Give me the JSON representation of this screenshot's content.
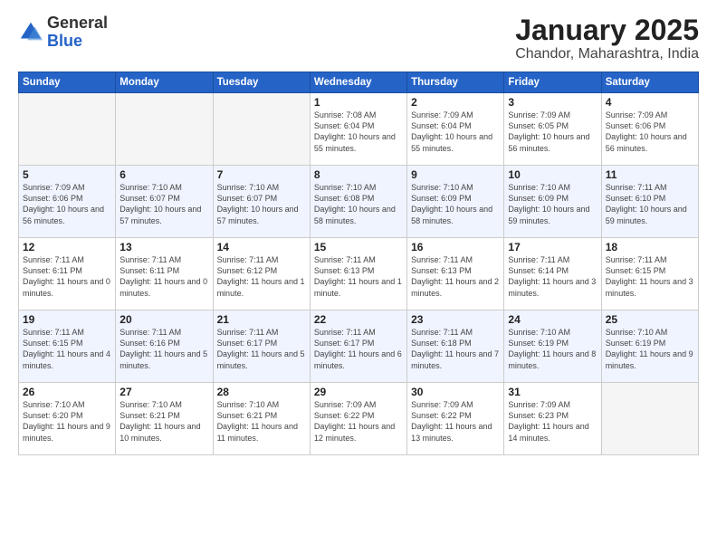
{
  "logo": {
    "general": "General",
    "blue": "Blue"
  },
  "title": "January 2025",
  "subtitle": "Chandor, Maharashtra, India",
  "days_of_week": [
    "Sunday",
    "Monday",
    "Tuesday",
    "Wednesday",
    "Thursday",
    "Friday",
    "Saturday"
  ],
  "weeks": [
    [
      {
        "num": "",
        "sunrise": "",
        "sunset": "",
        "daylight": "",
        "empty": true
      },
      {
        "num": "",
        "sunrise": "",
        "sunset": "",
        "daylight": "",
        "empty": true
      },
      {
        "num": "",
        "sunrise": "",
        "sunset": "",
        "daylight": "",
        "empty": true
      },
      {
        "num": "1",
        "sunrise": "Sunrise: 7:08 AM",
        "sunset": "Sunset: 6:04 PM",
        "daylight": "Daylight: 10 hours and 55 minutes.",
        "empty": false
      },
      {
        "num": "2",
        "sunrise": "Sunrise: 7:09 AM",
        "sunset": "Sunset: 6:04 PM",
        "daylight": "Daylight: 10 hours and 55 minutes.",
        "empty": false
      },
      {
        "num": "3",
        "sunrise": "Sunrise: 7:09 AM",
        "sunset": "Sunset: 6:05 PM",
        "daylight": "Daylight: 10 hours and 56 minutes.",
        "empty": false
      },
      {
        "num": "4",
        "sunrise": "Sunrise: 7:09 AM",
        "sunset": "Sunset: 6:06 PM",
        "daylight": "Daylight: 10 hours and 56 minutes.",
        "empty": false
      }
    ],
    [
      {
        "num": "5",
        "sunrise": "Sunrise: 7:09 AM",
        "sunset": "Sunset: 6:06 PM",
        "daylight": "Daylight: 10 hours and 56 minutes.",
        "empty": false
      },
      {
        "num": "6",
        "sunrise": "Sunrise: 7:10 AM",
        "sunset": "Sunset: 6:07 PM",
        "daylight": "Daylight: 10 hours and 57 minutes.",
        "empty": false
      },
      {
        "num": "7",
        "sunrise": "Sunrise: 7:10 AM",
        "sunset": "Sunset: 6:07 PM",
        "daylight": "Daylight: 10 hours and 57 minutes.",
        "empty": false
      },
      {
        "num": "8",
        "sunrise": "Sunrise: 7:10 AM",
        "sunset": "Sunset: 6:08 PM",
        "daylight": "Daylight: 10 hours and 58 minutes.",
        "empty": false
      },
      {
        "num": "9",
        "sunrise": "Sunrise: 7:10 AM",
        "sunset": "Sunset: 6:09 PM",
        "daylight": "Daylight: 10 hours and 58 minutes.",
        "empty": false
      },
      {
        "num": "10",
        "sunrise": "Sunrise: 7:10 AM",
        "sunset": "Sunset: 6:09 PM",
        "daylight": "Daylight: 10 hours and 59 minutes.",
        "empty": false
      },
      {
        "num": "11",
        "sunrise": "Sunrise: 7:11 AM",
        "sunset": "Sunset: 6:10 PM",
        "daylight": "Daylight: 10 hours and 59 minutes.",
        "empty": false
      }
    ],
    [
      {
        "num": "12",
        "sunrise": "Sunrise: 7:11 AM",
        "sunset": "Sunset: 6:11 PM",
        "daylight": "Daylight: 11 hours and 0 minutes.",
        "empty": false
      },
      {
        "num": "13",
        "sunrise": "Sunrise: 7:11 AM",
        "sunset": "Sunset: 6:11 PM",
        "daylight": "Daylight: 11 hours and 0 minutes.",
        "empty": false
      },
      {
        "num": "14",
        "sunrise": "Sunrise: 7:11 AM",
        "sunset": "Sunset: 6:12 PM",
        "daylight": "Daylight: 11 hours and 1 minute.",
        "empty": false
      },
      {
        "num": "15",
        "sunrise": "Sunrise: 7:11 AM",
        "sunset": "Sunset: 6:13 PM",
        "daylight": "Daylight: 11 hours and 1 minute.",
        "empty": false
      },
      {
        "num": "16",
        "sunrise": "Sunrise: 7:11 AM",
        "sunset": "Sunset: 6:13 PM",
        "daylight": "Daylight: 11 hours and 2 minutes.",
        "empty": false
      },
      {
        "num": "17",
        "sunrise": "Sunrise: 7:11 AM",
        "sunset": "Sunset: 6:14 PM",
        "daylight": "Daylight: 11 hours and 3 minutes.",
        "empty": false
      },
      {
        "num": "18",
        "sunrise": "Sunrise: 7:11 AM",
        "sunset": "Sunset: 6:15 PM",
        "daylight": "Daylight: 11 hours and 3 minutes.",
        "empty": false
      }
    ],
    [
      {
        "num": "19",
        "sunrise": "Sunrise: 7:11 AM",
        "sunset": "Sunset: 6:15 PM",
        "daylight": "Daylight: 11 hours and 4 minutes.",
        "empty": false
      },
      {
        "num": "20",
        "sunrise": "Sunrise: 7:11 AM",
        "sunset": "Sunset: 6:16 PM",
        "daylight": "Daylight: 11 hours and 5 minutes.",
        "empty": false
      },
      {
        "num": "21",
        "sunrise": "Sunrise: 7:11 AM",
        "sunset": "Sunset: 6:17 PM",
        "daylight": "Daylight: 11 hours and 5 minutes.",
        "empty": false
      },
      {
        "num": "22",
        "sunrise": "Sunrise: 7:11 AM",
        "sunset": "Sunset: 6:17 PM",
        "daylight": "Daylight: 11 hours and 6 minutes.",
        "empty": false
      },
      {
        "num": "23",
        "sunrise": "Sunrise: 7:11 AM",
        "sunset": "Sunset: 6:18 PM",
        "daylight": "Daylight: 11 hours and 7 minutes.",
        "empty": false
      },
      {
        "num": "24",
        "sunrise": "Sunrise: 7:10 AM",
        "sunset": "Sunset: 6:19 PM",
        "daylight": "Daylight: 11 hours and 8 minutes.",
        "empty": false
      },
      {
        "num": "25",
        "sunrise": "Sunrise: 7:10 AM",
        "sunset": "Sunset: 6:19 PM",
        "daylight": "Daylight: 11 hours and 9 minutes.",
        "empty": false
      }
    ],
    [
      {
        "num": "26",
        "sunrise": "Sunrise: 7:10 AM",
        "sunset": "Sunset: 6:20 PM",
        "daylight": "Daylight: 11 hours and 9 minutes.",
        "empty": false
      },
      {
        "num": "27",
        "sunrise": "Sunrise: 7:10 AM",
        "sunset": "Sunset: 6:21 PM",
        "daylight": "Daylight: 11 hours and 10 minutes.",
        "empty": false
      },
      {
        "num": "28",
        "sunrise": "Sunrise: 7:10 AM",
        "sunset": "Sunset: 6:21 PM",
        "daylight": "Daylight: 11 hours and 11 minutes.",
        "empty": false
      },
      {
        "num": "29",
        "sunrise": "Sunrise: 7:09 AM",
        "sunset": "Sunset: 6:22 PM",
        "daylight": "Daylight: 11 hours and 12 minutes.",
        "empty": false
      },
      {
        "num": "30",
        "sunrise": "Sunrise: 7:09 AM",
        "sunset": "Sunset: 6:22 PM",
        "daylight": "Daylight: 11 hours and 13 minutes.",
        "empty": false
      },
      {
        "num": "31",
        "sunrise": "Sunrise: 7:09 AM",
        "sunset": "Sunset: 6:23 PM",
        "daylight": "Daylight: 11 hours and 14 minutes.",
        "empty": false
      },
      {
        "num": "",
        "sunrise": "",
        "sunset": "",
        "daylight": "",
        "empty": true
      }
    ]
  ]
}
